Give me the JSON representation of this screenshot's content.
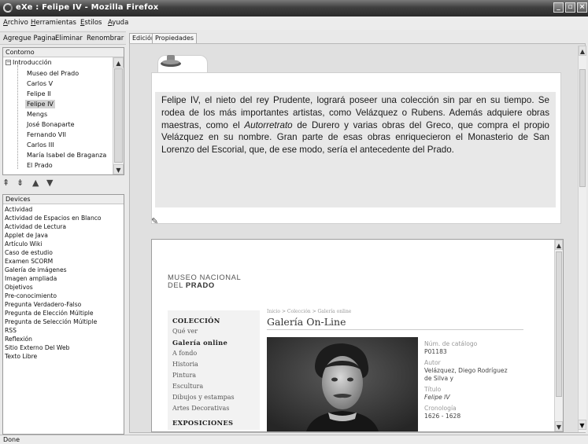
{
  "window": {
    "title": "eXe : Felipe IV - Mozilla Firefox"
  },
  "menubar": {
    "items": [
      "Archivo",
      "Herramientas",
      "Estilos",
      "Ayuda"
    ]
  },
  "left_toolbar": {
    "add_page": "Agregue Pagina",
    "delete": "Eliminar",
    "rename": "Renombrar"
  },
  "outline": {
    "header": "Contorno",
    "root": "Introducción",
    "items": [
      "Museo del Prado",
      "Carlos V",
      "Felipe II",
      "Felipe IV",
      "Mengs",
      "José Bonaparte",
      "Fernando VII",
      "Carlos III",
      "María Isabel de Braganza",
      "El Prado"
    ],
    "selected": "Felipe IV"
  },
  "devices": {
    "header": "Devices",
    "items": [
      "Actividad",
      "Actividad de Espacios en Blanco",
      "Actividad de Lectura",
      "Applet de Java",
      "Artículo Wiki",
      "Caso de estudio",
      "Examen SCORM",
      "Galería de imágenes",
      "Imagen ampliada",
      "Objetivos",
      "Pre-conocimiento",
      "Pregunta Verdadero-Falso",
      "Pregunta de Elección Múltiple",
      "Pregunta de Selección Múltiple",
      "RSS",
      "Reflexión",
      "Sitio Externo Del Web",
      "Texto Libre"
    ]
  },
  "tabs": {
    "edit": "Edición",
    "properties": "Propiedades"
  },
  "content": {
    "para_before": "Felipe IV, el nieto del rey Prudente, logrará poseer una colección sin par en su tiempo. Se rodea de los más importantes artistas, como Velázquez o Rubens. Además adquiere obras maestras, como el ",
    "para_italic": "Autorretrato",
    "para_after": " de Durero y varias obras del Greco, que compra el propio Velázquez en su nombre. Gran parte de esas obras enriquecieron el Monasterio de San Lorenzo del Escorial, que, de ese modo, sería el antecedente del Prado."
  },
  "webpage": {
    "logo_line1": "MUSEO NACIONAL",
    "logo_line2_prefix": "DEL ",
    "logo_line2_bold": "PRADO",
    "nav": [
      {
        "label": "COLECCIÓN",
        "heading": true
      },
      {
        "label": "Qué ver",
        "heading": false
      },
      {
        "label": "Galería online",
        "heading": true
      },
      {
        "label": "A fondo",
        "heading": false
      },
      {
        "label": "Historia",
        "heading": false
      },
      {
        "label": "Pintura",
        "heading": false
      },
      {
        "label": "Escultura",
        "heading": false
      },
      {
        "label": "Dibujos y estampas",
        "heading": false
      },
      {
        "label": "Artes Decorativas",
        "heading": false
      },
      {
        "label": "EXPOSICIONES",
        "heading": true
      }
    ],
    "breadcrumb": "Inicio > Colección > Galería online",
    "heading": "Galería On-Line",
    "meta": {
      "catalog_label": "Núm. de catálogo",
      "catalog_value": "P01183",
      "author_label": "Autor",
      "author_value_1": "Velázquez, Diego Rodríguez",
      "author_value_2": "de Silva y",
      "title_label": "Título",
      "title_value": "Felipe IV",
      "chronology_label": "Cronología",
      "chronology_value": "1626 - 1628"
    }
  },
  "statusbar": {
    "text": "Done"
  }
}
